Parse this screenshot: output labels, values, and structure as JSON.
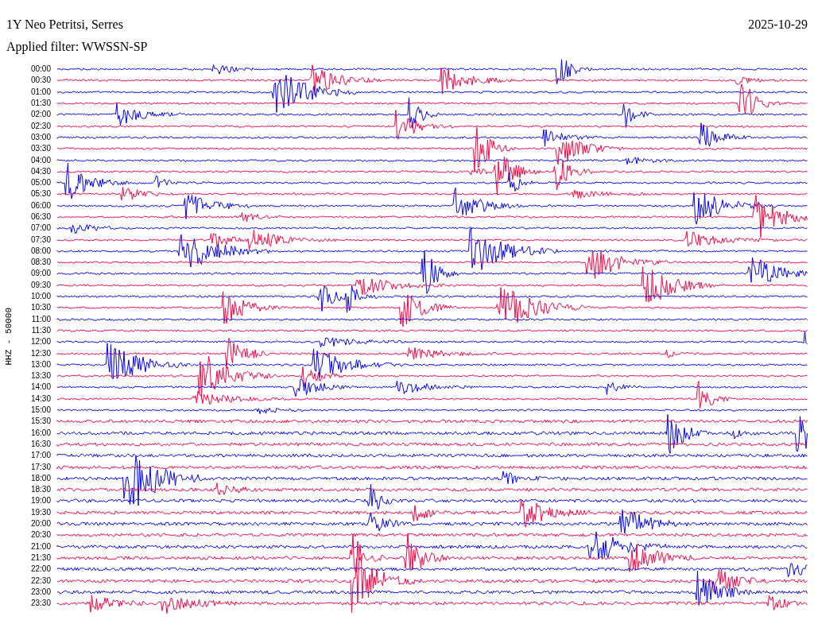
{
  "title": "1Y Neo Petritsi, Serres",
  "date": "2025-10-29",
  "filter": "Applied filter: WWSSN-SP",
  "axis_label": "HHZ - 50000",
  "rows": [
    {
      "time": "00:00",
      "color": "#0000ff"
    },
    {
      "time": "00:30",
      "color": "#ff0040"
    },
    {
      "time": "01:00",
      "color": "#0000ff"
    },
    {
      "time": "01:30",
      "color": "#ff0040"
    },
    {
      "time": "02:00",
      "color": "#0000ff"
    },
    {
      "time": "02:30",
      "color": "#ff0040"
    },
    {
      "time": "03:00",
      "color": "#0000ff"
    },
    {
      "time": "03:30",
      "color": "#ff0040"
    },
    {
      "time": "04:00",
      "color": "#0000ff"
    },
    {
      "time": "04:30",
      "color": "#ff0040"
    },
    {
      "time": "05:00",
      "color": "#0000ff"
    },
    {
      "time": "05:30",
      "color": "#ff0040"
    },
    {
      "time": "06:00",
      "color": "#0000ff"
    },
    {
      "time": "06:30",
      "color": "#ff0040"
    },
    {
      "time": "07:00",
      "color": "#0000ff"
    },
    {
      "time": "07:30",
      "color": "#ff0040"
    },
    {
      "time": "08:00",
      "color": "#0000ff"
    },
    {
      "time": "08:30",
      "color": "#ff0040"
    },
    {
      "time": "09:00",
      "color": "#0000ff"
    },
    {
      "time": "09:30",
      "color": "#ff0040"
    },
    {
      "time": "10:00",
      "color": "#0000ff"
    },
    {
      "time": "10:30",
      "color": "#ff0040"
    },
    {
      "time": "11:00",
      "color": "#0000ff"
    },
    {
      "time": "11:30",
      "color": "#ff0040"
    },
    {
      "time": "12:00",
      "color": "#0000ff"
    },
    {
      "time": "12:30",
      "color": "#ff0040"
    },
    {
      "time": "13:00",
      "color": "#0000ff"
    },
    {
      "time": "13:30",
      "color": "#ff0040"
    },
    {
      "time": "14:00",
      "color": "#0000ff"
    },
    {
      "time": "14:30",
      "color": "#ff0040"
    },
    {
      "time": "15:00",
      "color": "#0000ff"
    },
    {
      "time": "15:30",
      "color": "#ff0040"
    },
    {
      "time": "16:00",
      "color": "#0000ff"
    },
    {
      "time": "16:30",
      "color": "#ff0040"
    },
    {
      "time": "17:00",
      "color": "#0000ff"
    },
    {
      "time": "17:30",
      "color": "#ff0040"
    },
    {
      "time": "18:00",
      "color": "#0000ff"
    },
    {
      "time": "18:30",
      "color": "#ff0040"
    },
    {
      "time": "19:00",
      "color": "#0000ff"
    },
    {
      "time": "19:30",
      "color": "#ff0040"
    },
    {
      "time": "20:00",
      "color": "#0000ff"
    },
    {
      "time": "20:30",
      "color": "#ff0040"
    },
    {
      "time": "21:00",
      "color": "#0000ff"
    },
    {
      "time": "21:30",
      "color": "#ff0040"
    },
    {
      "time": "22:00",
      "color": "#0000ff"
    },
    {
      "time": "22:30",
      "color": "#ff0040"
    },
    {
      "time": "23:00",
      "color": "#0000ff"
    },
    {
      "time": "23:30",
      "color": "#ff0040"
    }
  ]
}
